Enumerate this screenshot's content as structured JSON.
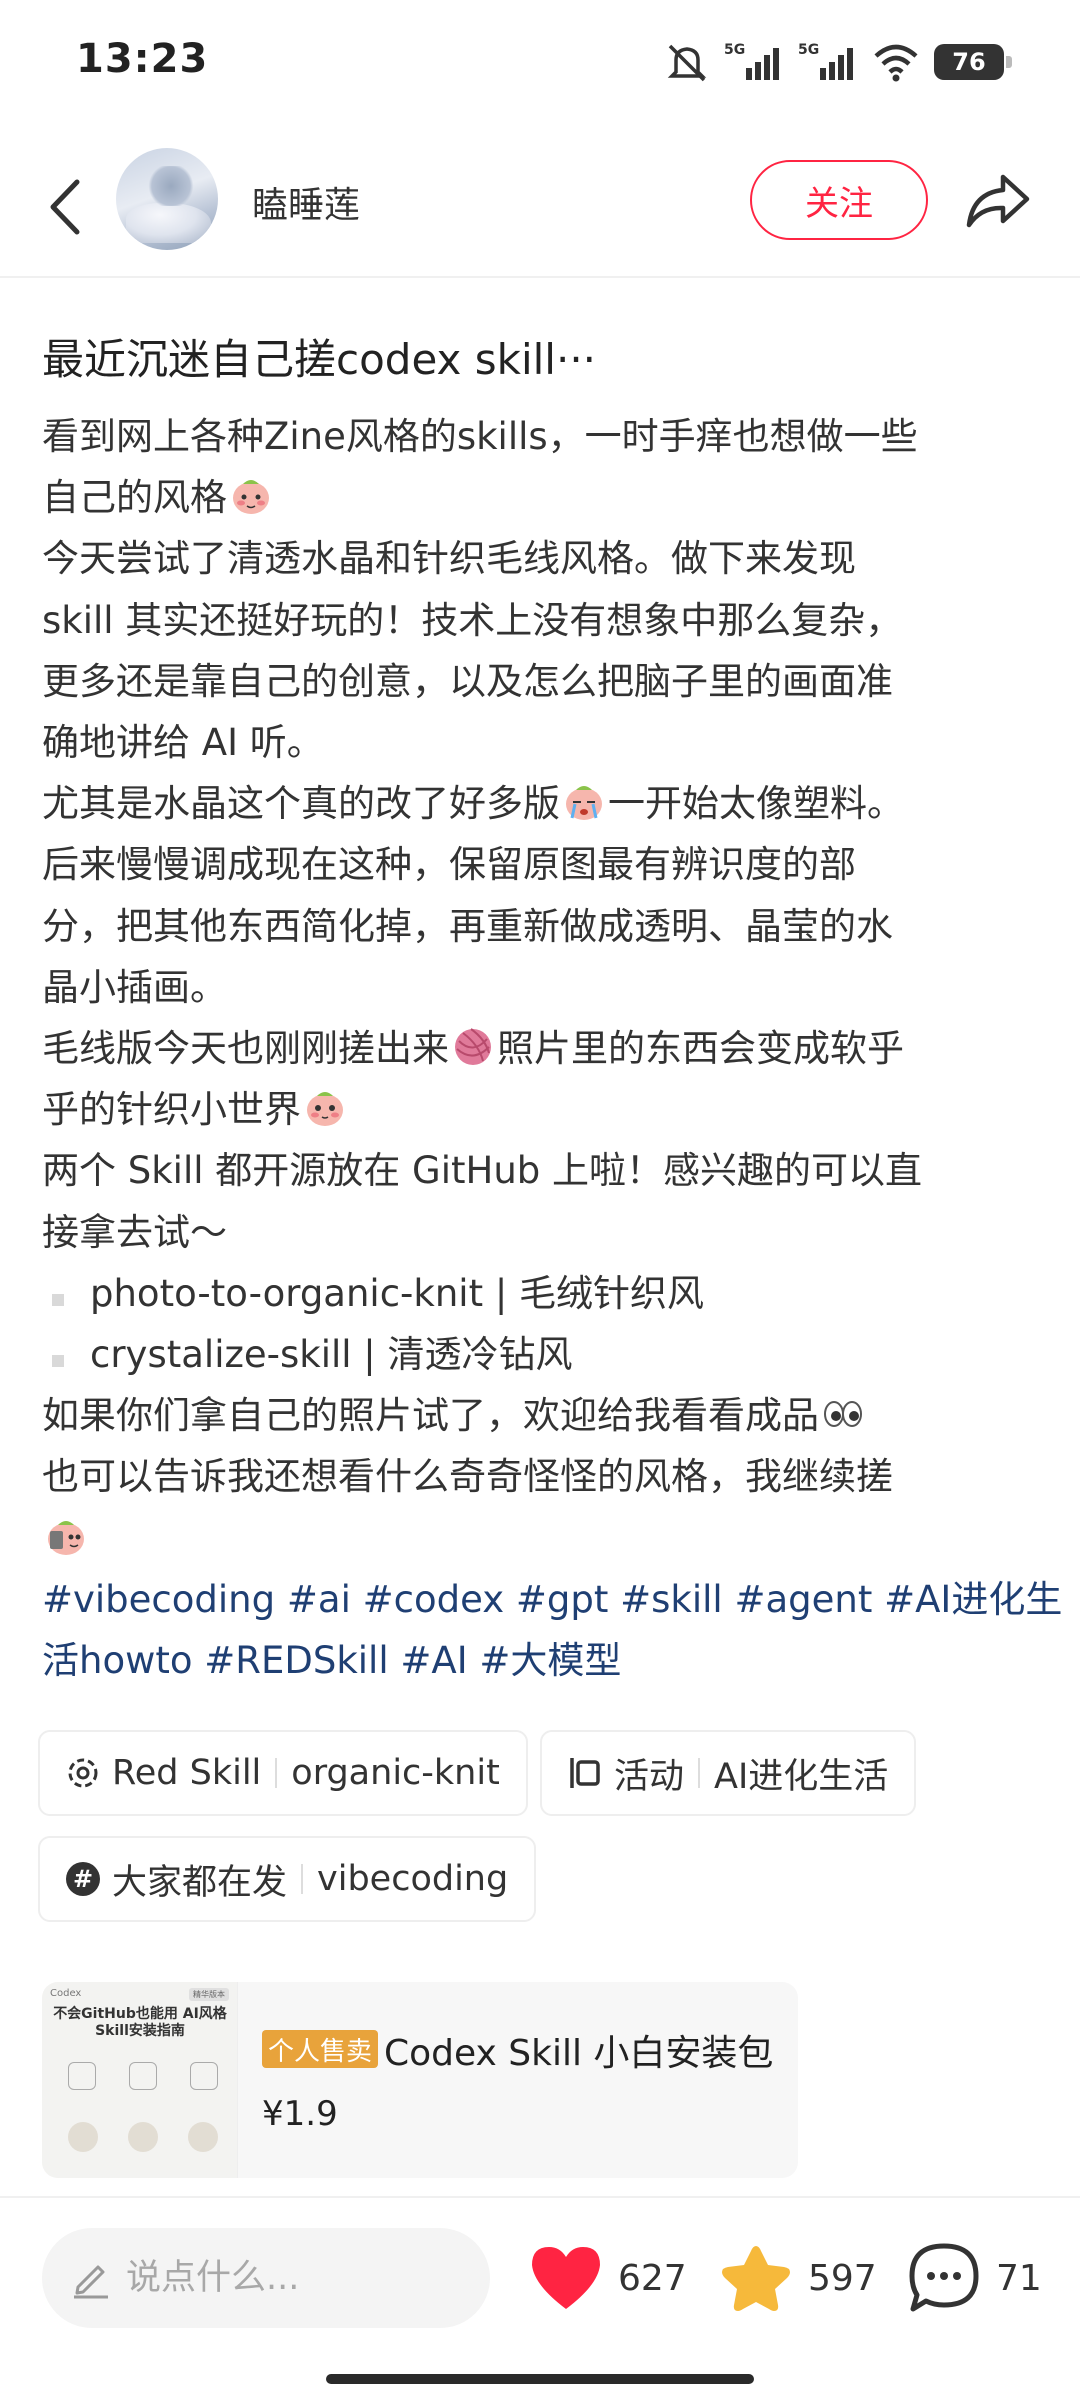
{
  "status_bar": {
    "time": "13:23",
    "battery": "76",
    "icons": [
      "mute-icon",
      "signal-5g-icon",
      "signal-5g-icon",
      "wifi-icon",
      "battery-icon"
    ]
  },
  "header": {
    "user_name": "瞌睡莲",
    "follow_label": "关注"
  },
  "post": {
    "title": "最近沉迷自己搓codex skill···",
    "lines": [
      "看到网上各种Zine风格的skills，一时手痒也想做一些",
      "自己的风格",
      "今天尝试了清透水晶和针织毛线风格。做下来发现",
      "skill 其实还挺好玩的！技术上没有想象中那么复杂，",
      "更多还是靠自己的创意，以及怎么把脑子里的画面准",
      "确地讲给 AI 听。",
      "尤其是水晶这个真的改了好多版",
      "一开始太像塑料。",
      "后来慢慢调成现在这种，保留原图最有辨识度的部",
      "分，把其他东西简化掉，再重新做成透明、晶莹的水",
      "晶小插画。",
      "毛线版今天也刚刚搓出来",
      "照片里的东西会变成软乎",
      "乎的针织小世界",
      "两个 Skill 都开源放在 GitHub 上啦！感兴趣的可以直",
      "接拿去试～",
      "photo-to-organic-knit | 毛绒针织风",
      "crystalize-skill | 清透冷钻风",
      "如果你们拿自己的照片试了，欢迎给我看看成品",
      "也可以告诉我还想看什么奇奇怪怪的风格，我继续搓"
    ],
    "tags_line1": [
      "#vibecoding",
      "#ai",
      "#codex",
      "#gpt",
      "#skill",
      "#agent",
      "#AI进化生"
    ],
    "tags_line2": [
      "活howto",
      "#REDSkill",
      "#AI",
      "#大模型"
    ]
  },
  "chips": [
    {
      "icon": "skill-gear-icon",
      "label": "Red Skill",
      "value": "organic-knit"
    },
    {
      "icon": "activity-icon",
      "label": "活动",
      "value": "AI进化生活"
    },
    {
      "icon": "hashtag-icon",
      "label": "大家都在发",
      "value": "vibecoding"
    }
  ],
  "product": {
    "badge": "个人售卖",
    "name": "Codex Skill 小白安装包",
    "price": "¥1.9",
    "thumb_brand": "Codex",
    "thumb_badge": "精华版本",
    "thumb_title": "不会GitHub也能用 AI风格Skill安装指南"
  },
  "bottom_bar": {
    "comment_placeholder": "说点什么...",
    "likes": "627",
    "favorites": "597",
    "comments": "71"
  },
  "colors": {
    "accent_red": "#ff2442",
    "tag_blue": "#1f3f73",
    "badge_orange": "#e8a33b",
    "star_yellow": "#f6b93b"
  }
}
